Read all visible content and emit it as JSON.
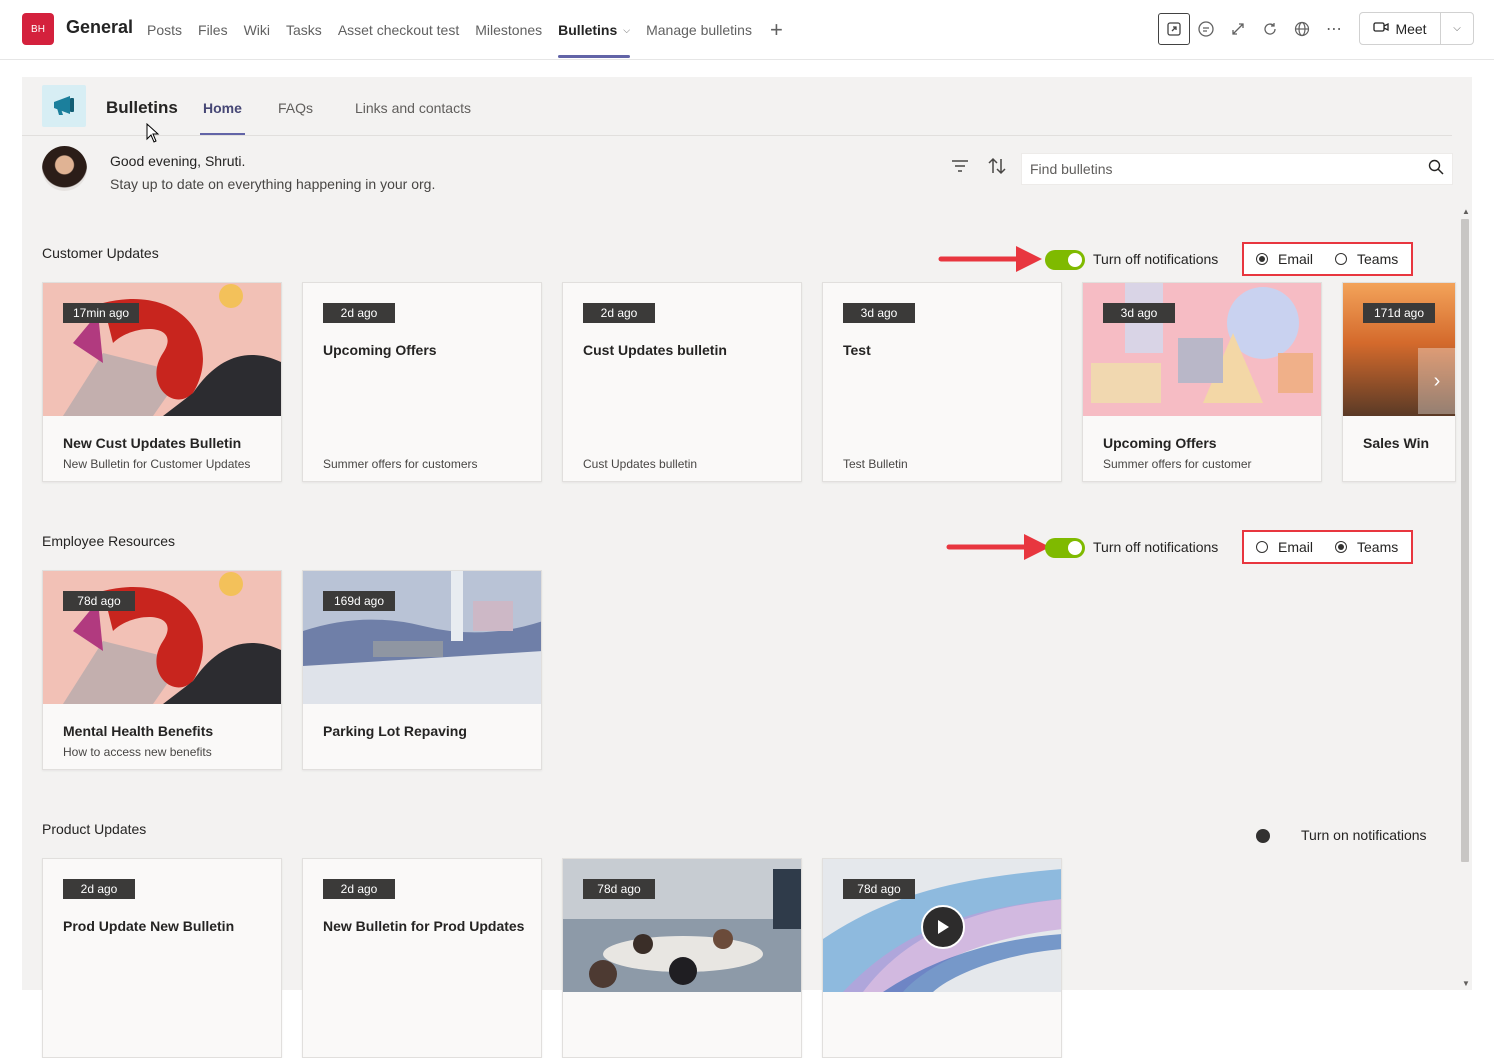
{
  "header": {
    "team_initials": "BH",
    "channel_name": "General",
    "tabs": [
      {
        "label": "Posts"
      },
      {
        "label": "Files"
      },
      {
        "label": "Wiki"
      },
      {
        "label": "Tasks"
      },
      {
        "label": "Asset checkout test"
      },
      {
        "label": "Milestones"
      },
      {
        "label": "Bulletins",
        "active": true
      },
      {
        "label": "Manage bulletins"
      }
    ],
    "add_tab": "+",
    "meet_label": "Meet"
  },
  "app": {
    "title": "Bulletins",
    "tabs": [
      {
        "label": "Home",
        "active": true
      },
      {
        "label": "FAQs"
      },
      {
        "label": "Links and contacts"
      }
    ],
    "greeting_line1": "Good evening, Shruti.",
    "greeting_line2": "Stay up to date on everything happening in your org.",
    "search_placeholder": "Find bulletins"
  },
  "sections": [
    {
      "title": "Customer Updates",
      "notification_label": "Turn off notifications",
      "channel_email": "Email",
      "channel_teams": "Teams",
      "selected_channel": "Email",
      "cards": [
        {
          "age": "17min ago",
          "title": "New Cust Updates Bulletin",
          "subtitle": "New Bulletin for Customer Updates"
        },
        {
          "age": "2d ago",
          "title": "Upcoming Offers",
          "subtitle": "Summer offers for customers"
        },
        {
          "age": "2d ago",
          "title": "Cust Updates bulletin",
          "subtitle": "Cust Updates bulletin"
        },
        {
          "age": "3d ago",
          "title": "Test",
          "subtitle": "Test Bulletin"
        },
        {
          "age": "3d ago",
          "title": "Upcoming Offers",
          "subtitle": "Summer offers for customer"
        },
        {
          "age": "171d ago",
          "title": "Sales Win",
          "subtitle": ""
        }
      ]
    },
    {
      "title": "Employee Resources",
      "notification_label": "Turn off notifications",
      "channel_email": "Email",
      "channel_teams": "Teams",
      "selected_channel": "Teams",
      "cards": [
        {
          "age": "78d ago",
          "title": "Mental Health Benefits",
          "subtitle": "How to access new benefits"
        },
        {
          "age": "169d ago",
          "title": "Parking Lot Repaving",
          "subtitle": ""
        }
      ]
    },
    {
      "title": "Product Updates",
      "notification_label": "Turn on notifications",
      "cards": [
        {
          "age": "2d ago",
          "title": "Prod Update New Bulletin"
        },
        {
          "age": "2d ago",
          "title": "New Bulletin for Prod Updates"
        },
        {
          "age": "78d ago",
          "title": ""
        },
        {
          "age": "78d ago",
          "title": ""
        }
      ]
    }
  ],
  "colors": {
    "accent": "#6264a7",
    "toggle_on": "#7fba00",
    "highlight_red": "#e8363f",
    "team_avatar": "#d4213d"
  }
}
